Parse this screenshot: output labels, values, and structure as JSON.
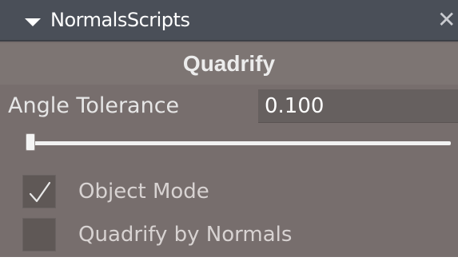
{
  "panel": {
    "title": "NormalsScripts",
    "collapse_icon": "triangle-down-icon",
    "close_icon": "close-icon",
    "close_glyph": "✕"
  },
  "section": {
    "header": "Quadrify"
  },
  "angle_tolerance": {
    "label": "Angle Tolerance",
    "value": "0.100",
    "slider_fraction": 0.0
  },
  "options": [
    {
      "label": "Object Mode",
      "checked": true
    },
    {
      "label": "Quadrify by Normals",
      "checked": false
    }
  ],
  "colors": {
    "panel_bg": "#776e6d",
    "titlebar_bg": "#4a4f58",
    "field_bg": "#66605f",
    "checkbox_bg": "#5f5856",
    "text_light": "#e6e6e6"
  }
}
